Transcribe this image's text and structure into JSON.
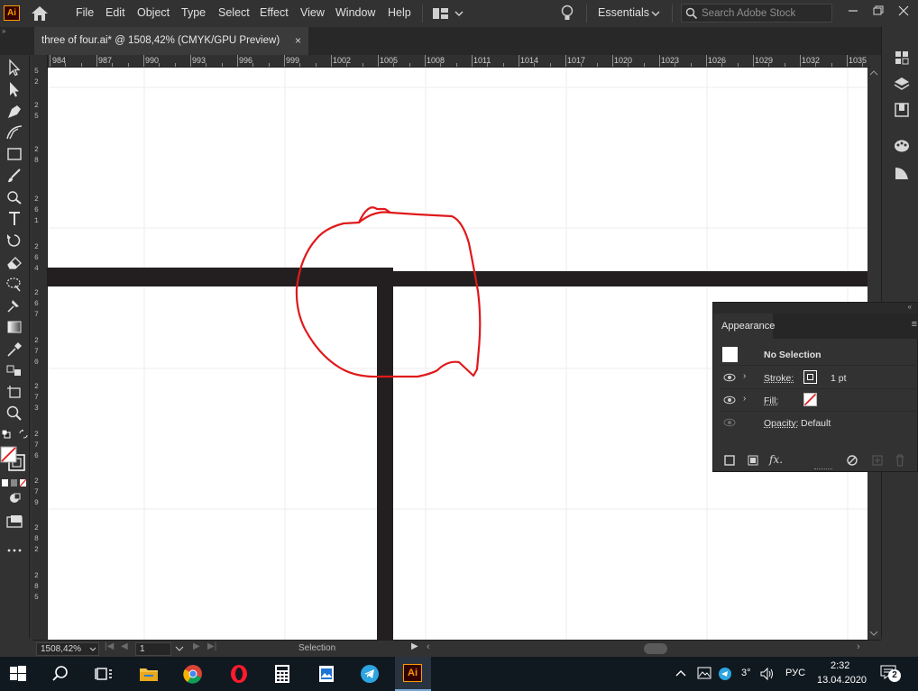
{
  "app": {
    "logo": "Ai"
  },
  "menu": {
    "items": [
      "File",
      "Edit",
      "Object",
      "Type",
      "Select",
      "Effect",
      "View",
      "Window",
      "Help"
    ],
    "workspace": "Essentials",
    "search_placeholder": "Search Adobe Stock"
  },
  "document_tab": {
    "title": "three of four.ai* @ 1508,42% (CMYK/GPU Preview)",
    "close": "×"
  },
  "ruler_h": {
    "labels": [
      "984",
      "987",
      "990",
      "993",
      "996",
      "999",
      "1002",
      "1005",
      "1008",
      "1011",
      "1014",
      "1017",
      "1020",
      "1023",
      "1026",
      "1029",
      "1032",
      "1035"
    ]
  },
  "ruler_v": {
    "labels": [
      "5",
      "2",
      "2",
      "5",
      "2",
      "8",
      "2",
      "6",
      "1",
      "2",
      "6",
      "4",
      "2",
      "6",
      "7",
      "2",
      "7",
      "0",
      "2",
      "7",
      "3",
      "2",
      "7",
      "6",
      "2",
      "7",
      "9",
      "2",
      "8",
      "2",
      "2",
      "8",
      "5"
    ]
  },
  "appearance_panel": {
    "tab": "Appearance",
    "selection": "No Selection",
    "stroke_label": "Stroke:",
    "stroke_value": "1 pt",
    "fill_label": "Fill:",
    "opacity_label": "Opacity:",
    "opacity_value": "Default",
    "fx_label": "fx."
  },
  "status": {
    "zoom": "1508,42%",
    "page": "1",
    "tool": "Selection"
  },
  "taskbar": {
    "time": "2:32",
    "date": "13.04.2020",
    "lang": "РУС",
    "temp": "3°",
    "notifications": "2"
  },
  "colors": {
    "accent_ai": "#ff9a00",
    "canvas": "#ffffff",
    "shape": "#231f20",
    "annotation": "#e0191b",
    "ui_dark": "#323232"
  }
}
